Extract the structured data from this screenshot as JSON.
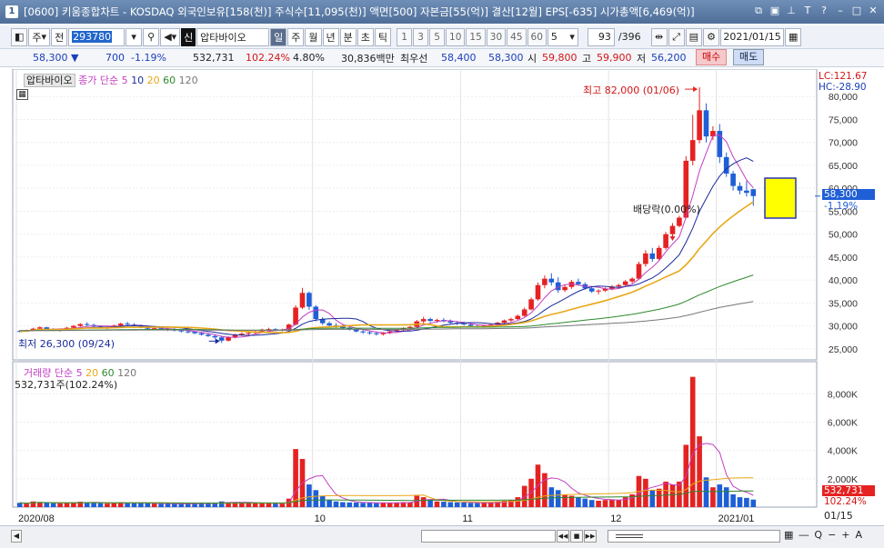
{
  "window": {
    "number": "1",
    "title": "[0600] 키움종합차트 - KOSDAQ 외국인보유[158(천)] 주식수[11,095(천)] 액면[500] 자본금[55(억)] 결산[12월] EPS[-635] 시가총액[6,469(억)]"
  },
  "toolbar": {
    "period_left": "주",
    "prev": "전",
    "code": "293780",
    "sin": "신",
    "stock_name": "압타바이오",
    "periods": [
      "일",
      "주",
      "월",
      "년",
      "분",
      "초",
      "틱"
    ],
    "selected_period": "일",
    "minutes": [
      "1",
      "3",
      "5",
      "10",
      "15",
      "30",
      "45",
      "60"
    ],
    "count_select": "5",
    "page": "93",
    "page_total": "/396",
    "date": "2021/01/15"
  },
  "quote": {
    "price": "58,300",
    "change": "700",
    "change_pct": "-1.19%",
    "volume": "532,731",
    "volume_ratio": "102.24%",
    "turnover": "4.80%",
    "amount": "30,836백만",
    "best_ask_label": "최우선",
    "best_ask": "58,400",
    "best_bid": "58,300",
    "open_label": "시",
    "open": "59,800",
    "high_label": "고",
    "high": "59,900",
    "low_label": "저",
    "low": "56,200",
    "buy_label": "매수",
    "sell_label": "매도"
  },
  "price_panel": {
    "stock": "압타바이오",
    "indicator": "종가 단순",
    "ma": [
      "5",
      "10",
      "20",
      "60",
      "120"
    ],
    "lc": "LC:121.67",
    "hc": "HC:-28.90",
    "max_label": "최고 82,000 (01/06)",
    "min_label": "최저 26,300 (09/24)",
    "dividend_label": "배당락(0.00%)",
    "current_price": "58,300",
    "current_pct": "-1.19%",
    "y_ticks": [
      "80,000",
      "75,000",
      "70,000",
      "65,000",
      "60,000",
      "55,000",
      "50,000",
      "45,000",
      "40,000",
      "35,000",
      "30,000",
      "25,000"
    ]
  },
  "volume_panel": {
    "title": "거래량 단순",
    "ma": [
      "5",
      "20",
      "60",
      "120"
    ],
    "current": "532,731주(102.24%)",
    "current_value": "532,731",
    "current_pct": "102.24%",
    "y_ticks": [
      "8,000K",
      "6,000K",
      "4,000K",
      "2,000K"
    ]
  },
  "x_axis": {
    "labels": [
      "2020/08",
      "10",
      "11",
      "12",
      "2021/01"
    ],
    "right": "01/15"
  },
  "colors": {
    "up": "#e52222",
    "down": "#1f5fd6",
    "ma5": "#c23ec2",
    "ma10": "#1a2b9c",
    "ma20": "#e8a817",
    "ma60": "#2d8a2d",
    "ma120": "#777777"
  },
  "chart_data": {
    "type": "candlestick",
    "x_range": [
      "2020/07/29",
      "2021/01/15"
    ],
    "ylim": [
      23000,
      84000
    ],
    "volume_ylim": [
      0,
      9500000
    ],
    "highlights": {
      "max": {
        "date": "01/06",
        "value": 82000
      },
      "min": {
        "date": "09/24",
        "value": 26300
      }
    },
    "candles": [
      [
        28900,
        29100,
        28600,
        28800,
        300000
      ],
      [
        28800,
        29200,
        28700,
        29000,
        250000
      ],
      [
        29000,
        29600,
        28900,
        29400,
        400000
      ],
      [
        29400,
        29900,
        29200,
        29700,
        350000
      ],
      [
        29700,
        29800,
        29100,
        29300,
        300000
      ],
      [
        29300,
        29500,
        28900,
        29100,
        280000
      ],
      [
        29100,
        29400,
        28800,
        29300,
        260000
      ],
      [
        29300,
        29800,
        29100,
        29600,
        300000
      ],
      [
        29600,
        30200,
        29500,
        30000,
        350000
      ],
      [
        30000,
        30600,
        29800,
        30400,
        380000
      ],
      [
        30400,
        30800,
        30000,
        30200,
        330000
      ],
      [
        30200,
        30500,
        29700,
        29900,
        300000
      ],
      [
        29900,
        30100,
        29400,
        29600,
        280000
      ],
      [
        29600,
        30000,
        29300,
        29800,
        250000
      ],
      [
        29800,
        30300,
        29600,
        30100,
        300000
      ],
      [
        30100,
        30700,
        30000,
        30500,
        350000
      ],
      [
        30500,
        30900,
        30100,
        30300,
        300000
      ],
      [
        30300,
        30600,
        29900,
        30000,
        280000
      ],
      [
        30000,
        30300,
        29500,
        29700,
        300000
      ],
      [
        29700,
        29900,
        29200,
        29400,
        260000
      ],
      [
        29400,
        29800,
        29100,
        29500,
        250000
      ],
      [
        29500,
        29800,
        29100,
        29300,
        240000
      ],
      [
        29300,
        29600,
        28900,
        29200,
        230000
      ],
      [
        29200,
        29500,
        28800,
        29000,
        250000
      ],
      [
        29000,
        29300,
        28600,
        28800,
        240000
      ],
      [
        28800,
        29100,
        28400,
        28700,
        250000
      ],
      [
        28700,
        28900,
        28200,
        28400,
        260000
      ],
      [
        28400,
        28700,
        27900,
        28100,
        270000
      ],
      [
        28100,
        28500,
        27600,
        27800,
        280000
      ],
      [
        27800,
        28200,
        27200,
        27500,
        300000
      ],
      [
        27500,
        27900,
        26300,
        26800,
        400000
      ],
      [
        26800,
        27800,
        26600,
        27500,
        350000
      ],
      [
        27500,
        28300,
        27300,
        28000,
        330000
      ],
      [
        28000,
        28600,
        27800,
        28300,
        300000
      ],
      [
        28300,
        28800,
        28000,
        28500,
        280000
      ],
      [
        28500,
        29100,
        28300,
        28800,
        300000
      ],
      [
        28800,
        29400,
        28600,
        29200,
        280000
      ],
      [
        29200,
        29600,
        28900,
        29300,
        300000
      ],
      [
        29300,
        29500,
        28900,
        29100,
        260000
      ],
      [
        29100,
        29400,
        28800,
        29200,
        250000
      ],
      [
        29200,
        30500,
        29100,
        30300,
        600000
      ],
      [
        30300,
        34500,
        30100,
        34000,
        4100000
      ],
      [
        34000,
        38300,
        33700,
        37200,
        3400000
      ],
      [
        37200,
        37500,
        33500,
        34200,
        1600000
      ],
      [
        34200,
        34500,
        31000,
        31500,
        1200000
      ],
      [
        31500,
        31900,
        30200,
        30600,
        800000
      ],
      [
        30600,
        31000,
        29800,
        30100,
        500000
      ],
      [
        30100,
        30600,
        29600,
        29900,
        400000
      ],
      [
        29900,
        30300,
        29300,
        29500,
        350000
      ],
      [
        29500,
        29900,
        29000,
        29300,
        330000
      ],
      [
        29300,
        29600,
        28600,
        28800,
        320000
      ],
      [
        28800,
        29200,
        28300,
        28600,
        300000
      ],
      [
        28600,
        29000,
        28100,
        28400,
        300000
      ],
      [
        28400,
        28800,
        27900,
        28200,
        280000
      ],
      [
        28200,
        28700,
        27900,
        28500,
        300000
      ],
      [
        28500,
        29000,
        28200,
        28800,
        300000
      ],
      [
        28800,
        29300,
        28500,
        29100,
        320000
      ],
      [
        29100,
        29700,
        28900,
        29500,
        350000
      ],
      [
        29500,
        30000,
        29200,
        29800,
        330000
      ],
      [
        29800,
        31300,
        29600,
        31000,
        800000
      ],
      [
        31000,
        32000,
        30500,
        31500,
        700000
      ],
      [
        31500,
        31800,
        30800,
        31100,
        500000
      ],
      [
        31100,
        31600,
        30700,
        31300,
        400000
      ],
      [
        31300,
        31700,
        30800,
        31000,
        380000
      ],
      [
        31000,
        31400,
        30500,
        30700,
        350000
      ],
      [
        30700,
        31100,
        30200,
        30500,
        330000
      ],
      [
        30500,
        30900,
        30100,
        30300,
        320000
      ],
      [
        30300,
        30700,
        29800,
        30000,
        300000
      ],
      [
        30000,
        30400,
        29600,
        29800,
        280000
      ],
      [
        29800,
        30300,
        29600,
        30100,
        300000
      ],
      [
        30100,
        30500,
        29800,
        30300,
        320000
      ],
      [
        30300,
        30900,
        30100,
        30700,
        380000
      ],
      [
        30700,
        31400,
        30500,
        31200,
        450000
      ],
      [
        31200,
        31800,
        30900,
        31500,
        500000
      ],
      [
        31500,
        32500,
        31300,
        32200,
        700000
      ],
      [
        32200,
        34000,
        32000,
        33600,
        1500000
      ],
      [
        33600,
        36200,
        33400,
        35800,
        2000000
      ],
      [
        35800,
        39500,
        35500,
        38900,
        3000000
      ],
      [
        38900,
        41000,
        38200,
        40300,
        2400000
      ],
      [
        40300,
        41500,
        38800,
        39500,
        1400000
      ],
      [
        39500,
        40600,
        37200,
        37800,
        1200000
      ],
      [
        37800,
        39000,
        37400,
        38500,
        900000
      ],
      [
        38500,
        40000,
        38100,
        39600,
        800000
      ],
      [
        39600,
        40300,
        38800,
        39100,
        700000
      ],
      [
        39100,
        39500,
        37900,
        38200,
        600000
      ],
      [
        38200,
        38600,
        37200,
        37500,
        500000
      ],
      [
        37500,
        38000,
        36900,
        37700,
        450000
      ],
      [
        37700,
        38400,
        37400,
        38100,
        500000
      ],
      [
        38100,
        38900,
        37800,
        38600,
        550000
      ],
      [
        38600,
        39200,
        38100,
        38900,
        500000
      ],
      [
        38900,
        40000,
        38700,
        39700,
        700000
      ],
      [
        39700,
        40600,
        39300,
        40300,
        900000
      ],
      [
        40300,
        44000,
        40100,
        43500,
        2200000
      ],
      [
        43500,
        46500,
        42900,
        45800,
        2000000
      ],
      [
        45800,
        47000,
        44000,
        44600,
        1200000
      ],
      [
        44600,
        47500,
        44200,
        47000,
        1300000
      ],
      [
        47000,
        50500,
        46600,
        50000,
        1800000
      ],
      [
        50000,
        52400,
        49100,
        51800,
        1600000
      ],
      [
        51800,
        54000,
        51500,
        53600,
        1800000
      ],
      [
        53600,
        67000,
        53400,
        66000,
        4400000
      ],
      [
        66000,
        76000,
        65000,
        70500,
        9200000
      ],
      [
        70500,
        82000,
        69800,
        77000,
        5000000
      ],
      [
        77000,
        78500,
        70000,
        71300,
        2100000
      ],
      [
        71300,
        73500,
        70500,
        72500,
        1400000
      ],
      [
        72500,
        74000,
        65500,
        66800,
        1600000
      ],
      [
        66800,
        67800,
        62500,
        63200,
        1400000
      ],
      [
        63200,
        63800,
        59500,
        60500,
        900000
      ],
      [
        60500,
        61300,
        58700,
        59500,
        700000
      ],
      [
        59500,
        61600,
        58200,
        59000,
        650000
      ],
      [
        59800,
        59900,
        56200,
        58300,
        532731
      ]
    ]
  }
}
